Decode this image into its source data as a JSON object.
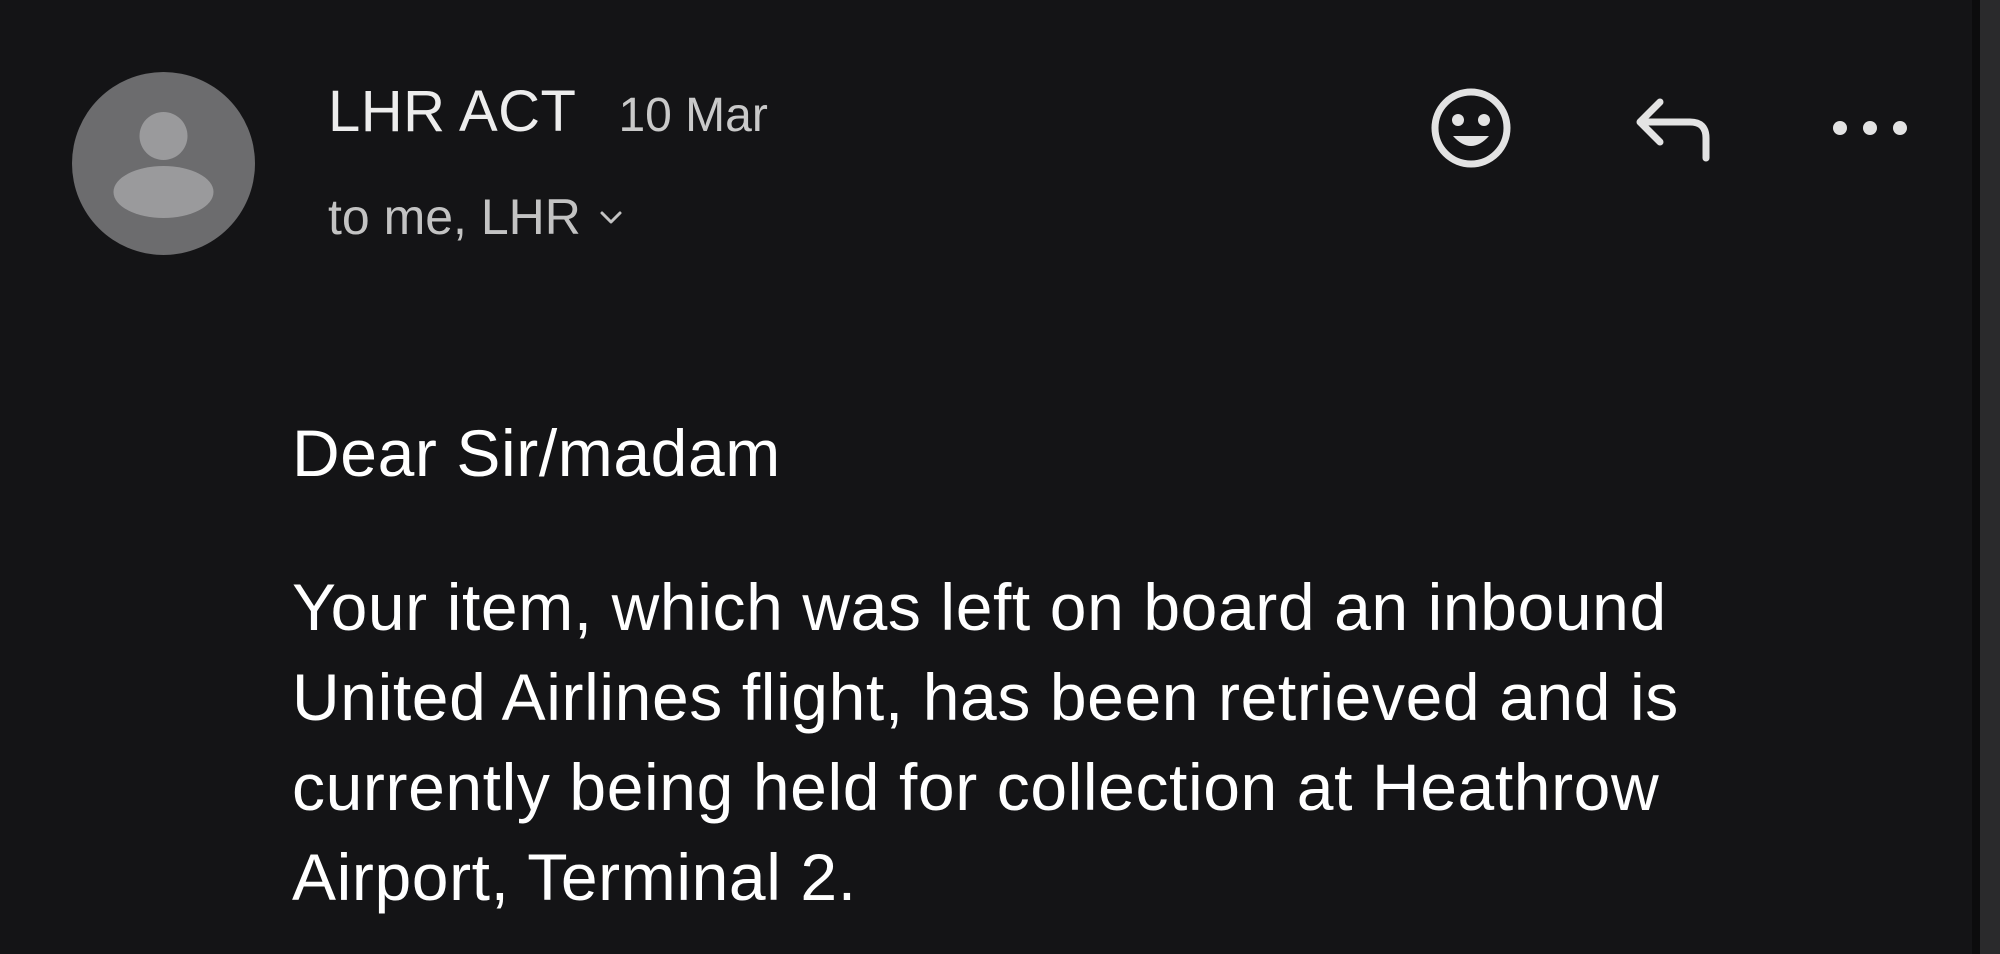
{
  "email": {
    "sender": "LHR ACT",
    "date": "10 Mar",
    "recipients": "to me, LHR",
    "greeting": "Dear Sir/madam",
    "body": "Your item, which was left on board an inbound United Airlines flight, has been retrieved and is currently being held for collection at Heathrow Airport, Terminal 2."
  },
  "icons": {
    "avatar": "person-icon",
    "recipients_toggle": "chevron-down-icon",
    "react": "smiley-icon",
    "reply": "reply-icon",
    "more": "more-options-icon"
  },
  "colors": {
    "background": "#141416",
    "avatar_bg": "#6c6c6e",
    "icon": "#e3e3e3",
    "text_primary": "#ffffff",
    "text_secondary": "#c3c3c3"
  }
}
